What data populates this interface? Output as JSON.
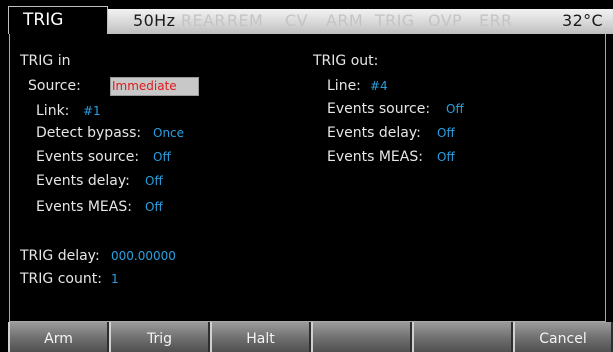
{
  "header": {
    "mode": "TRIG",
    "indicators": [
      {
        "label": "50Hz",
        "active": true
      },
      {
        "label": "REAR",
        "active": false
      },
      {
        "label": "REM",
        "active": false
      },
      {
        "label": "CV",
        "active": false
      },
      {
        "label": "ARM",
        "active": false
      },
      {
        "label": "TRIG",
        "active": false
      },
      {
        "label": "OVP",
        "active": false
      },
      {
        "label": "ERR",
        "active": false
      }
    ],
    "temperature": "32°C"
  },
  "trig_in": {
    "title": "TRIG in",
    "source_label": "Source:",
    "source_value": "Immediate",
    "link_label": "Link:",
    "link_value": "#1",
    "detect_bypass_label": "Detect bypass:",
    "detect_bypass_value": "Once",
    "events_source_label": "Events source:",
    "events_source_value": "Off",
    "events_delay_label": "Events delay:",
    "events_delay_value": "Off",
    "events_meas_label": "Events MEAS:",
    "events_meas_value": "Off"
  },
  "trig_out": {
    "title": "TRIG out:",
    "line_label": "Line:",
    "line_value": "#4",
    "events_source_label": "Events source:",
    "events_source_value": "Off",
    "events_delay_label": "Events delay:",
    "events_delay_value": "Off",
    "events_meas_label": "Events MEAS:",
    "events_meas_value": "Off"
  },
  "trig_delay": {
    "label": "TRIG delay:",
    "value": "000.00000"
  },
  "trig_count": {
    "label": "TRIG count:",
    "value": "1"
  },
  "softkeys": [
    "Arm",
    "Trig",
    "Halt",
    "",
    "",
    "Cancel"
  ],
  "colors": {
    "value": "#2a9fe0",
    "selected_value": "#e01b1b",
    "selected_background": "#c8c8c8",
    "header_bar": "#d8d8d8"
  }
}
